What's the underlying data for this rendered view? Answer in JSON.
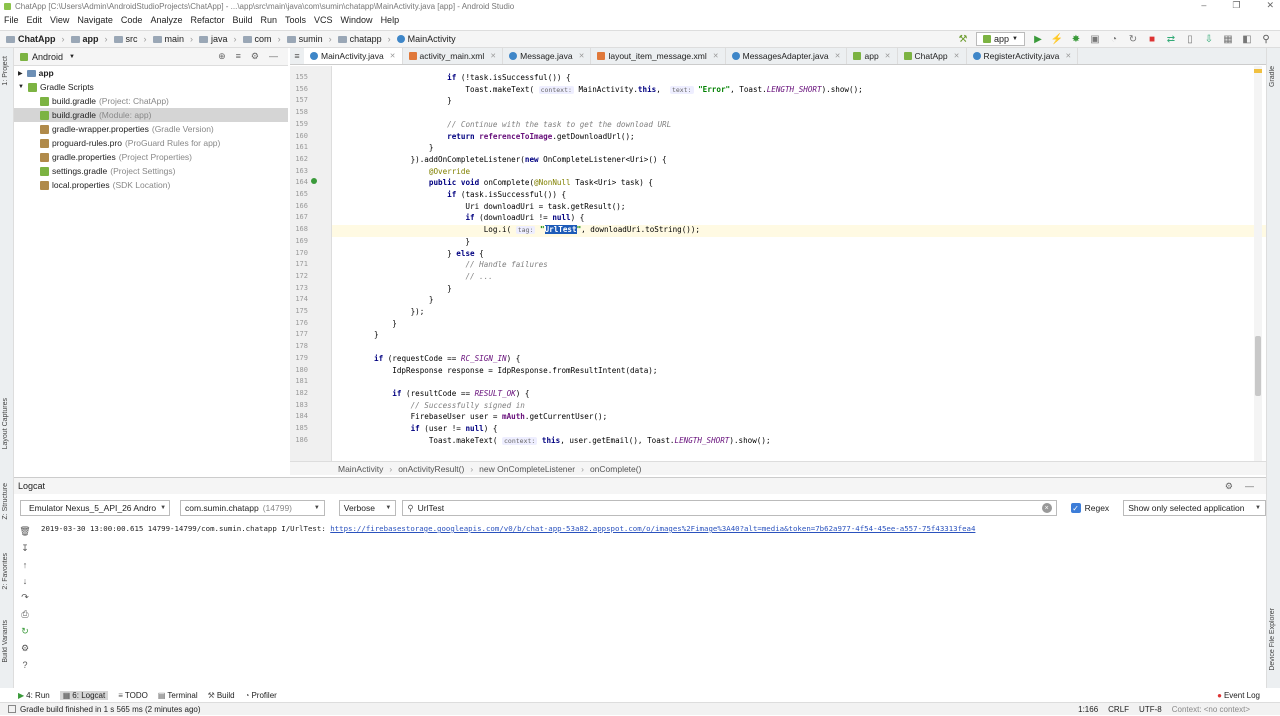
{
  "window": {
    "title": "ChatApp [C:\\Users\\Admin\\AndroidStudioProjects\\ChatApp] - ...\\app\\src\\main\\java\\com\\sumin\\chatapp\\MainActivity.java [app] - Android Studio"
  },
  "menu": [
    "File",
    "Edit",
    "View",
    "Navigate",
    "Code",
    "Analyze",
    "Refactor",
    "Build",
    "Run",
    "Tools",
    "VCS",
    "Window",
    "Help"
  ],
  "breadcrumbs": [
    "ChatApp",
    "app",
    "src",
    "main",
    "java",
    "com",
    "sumin",
    "chatapp",
    "MainActivity"
  ],
  "run_config": "app",
  "project_view": {
    "selector": "Android",
    "app_label": "app",
    "gradle_label": "Gradle Scripts",
    "items": [
      {
        "name": "build.gradle",
        "note": "(Project: ChatApp)"
      },
      {
        "name": "build.gradle",
        "note": "(Module: app)"
      },
      {
        "name": "gradle-wrapper.properties",
        "note": "(Gradle Version)"
      },
      {
        "name": "proguard-rules.pro",
        "note": "(ProGuard Rules for app)"
      },
      {
        "name": "gradle.properties",
        "note": "(Project Properties)"
      },
      {
        "name": "settings.gradle",
        "note": "(Project Settings)"
      },
      {
        "name": "local.properties",
        "note": "(SDK Location)"
      }
    ]
  },
  "side_labels": {
    "project": "1: Project",
    "layout": "Layout Captures",
    "structure": "Z: Structure",
    "favorites": "2: Favorites",
    "build_variants": "Build Variants",
    "gradle": "Gradle",
    "device_explorer": "Device File Explorer"
  },
  "tabs": [
    {
      "label": "MainActivity.java",
      "kind": "java"
    },
    {
      "label": "activity_main.xml",
      "kind": "xml"
    },
    {
      "label": "Message.java",
      "kind": "java"
    },
    {
      "label": "layout_item_message.xml",
      "kind": "xml"
    },
    {
      "label": "MessagesAdapter.java",
      "kind": "java"
    },
    {
      "label": "app",
      "kind": "gradle"
    },
    {
      "label": "ChatApp",
      "kind": "gradle"
    },
    {
      "label": "RegisterActivity.java",
      "kind": "java"
    }
  ],
  "code_lines": [
    {
      "n": "155",
      "html": "                <span class=\"kw\">if</span> (!task.isSuccessful()) {"
    },
    {
      "n": "156",
      "html": "                    Toast.makeText( <span class=\"hint\">context:</span> MainActivity.<span class=\"kw\">this</span>,  <span class=\"hint\">text:</span> <span class=\"str\">\"Error\"</span>, Toast.<span class=\"sf\">LENGTH_SHORT</span>).show();"
    },
    {
      "n": "157",
      "html": "                }"
    },
    {
      "n": "158",
      "html": ""
    },
    {
      "n": "159",
      "html": "                <span class=\"cm\">// Continue with the task to get the download URL</span>"
    },
    {
      "n": "160",
      "html": "                <span class=\"kw\">return</span> <span class=\"fd\">referenceToImage</span>.getDownloadUrl();"
    },
    {
      "n": "161",
      "html": "            }"
    },
    {
      "n": "162",
      "html": "        }).addOnCompleteListener(<span class=\"kw\">new</span> OnCompleteListener&lt;Uri&gt;() {"
    },
    {
      "n": "163",
      "html": "            <span class=\"an\">@Override</span>"
    },
    {
      "n": "164",
      "html": "            <span class=\"kw\">public void</span> onComplete(<span class=\"an\">@NonNull</span> Task&lt;Uri&gt; task) {"
    },
    {
      "n": "165",
      "html": "                <span class=\"kw\">if</span> (task.isSuccessful()) {"
    },
    {
      "n": "166",
      "html": "                    Uri downloadUri = task.getResult();"
    },
    {
      "n": "167",
      "html": "                    <span class=\"kw\">if</span> (downloadUri != <span class=\"kw\">null</span>) {"
    },
    {
      "n": "168",
      "html": "                        Log.i( <span class=\"hint\">tag:</span> <span class=\"str\">\"<span class=\"hl\">UrlTest</span>\"</span>, downloadUri.toString());"
    },
    {
      "n": "169",
      "html": "                    }"
    },
    {
      "n": "170",
      "html": "                } <span class=\"kw\">else</span> {"
    },
    {
      "n": "171",
      "html": "                    <span class=\"cm\">// Handle failures</span>"
    },
    {
      "n": "172",
      "html": "                    <span class=\"cm\">// ...</span>"
    },
    {
      "n": "173",
      "html": "                }"
    },
    {
      "n": "174",
      "html": "            }"
    },
    {
      "n": "175",
      "html": "        });"
    },
    {
      "n": "176",
      "html": "    }"
    },
    {
      "n": "177",
      "html": "}"
    },
    {
      "n": "178",
      "html": ""
    },
    {
      "n": "179",
      "html": "<span class=\"kw\">if</span> (requestCode == <span class=\"sf\">RC_SIGN_IN</span>) {"
    },
    {
      "n": "180",
      "html": "    IdpResponse response = IdpResponse.fromResultIntent(data);"
    },
    {
      "n": "181",
      "html": ""
    },
    {
      "n": "182",
      "html": "    <span class=\"kw\">if</span> (resultCode == <span class=\"sf\">RESULT_OK</span>) {"
    },
    {
      "n": "183",
      "html": "        <span class=\"cm\">// Successfully signed in</span>"
    },
    {
      "n": "184",
      "html": "        FirebaseUser user = <span class=\"fd\">mAuth</span>.getCurrentUser();"
    },
    {
      "n": "185",
      "html": "        <span class=\"kw\">if</span> (user != <span class=\"kw\">null</span>) {"
    },
    {
      "n": "186",
      "html": "            Toast.makeText( <span class=\"hint\">context:</span> <span class=\"kw\">this</span>, user.getEmail(), Toast.<span class=\"sf\">LENGTH_SHORT</span>).show();"
    }
  ],
  "editor_breadcrumb": [
    "MainActivity",
    "onActivityResult()",
    "new OnCompleteListener",
    "onComplete()"
  ],
  "logcat": {
    "title": "Logcat",
    "device": "Emulator Nexus_5_API_26 Andro",
    "process": "com.sumin.chatapp",
    "pid": "(14799)",
    "level": "Verbose",
    "search": "UrlTest",
    "regex_label": "Regex",
    "filter": "Show only selected application",
    "line_prefix": "2019-03-30 13:00:00.615 14799-14799/com.sumin.chatapp I/UrlTest: ",
    "line_url": "https://firebasestorage.googleapis.com/v0/b/chat-app-53a82.appspot.com/o/images%2Fimage%3A40?alt=media&token=7b62a977-4f54-45ee-a557-75f43313fea4"
  },
  "bottom_tools": [
    "4: Run",
    "6: Logcat",
    "TODO",
    "Terminal",
    "Build",
    "Profiler"
  ],
  "event_log": "Event Log",
  "status": {
    "message": "Gradle build finished in 1 s 565 ms (2 minutes ago)",
    "position": "1:166",
    "line_sep": "CRLF",
    "encoding": "UTF-8",
    "context": "Context: <no context>"
  }
}
